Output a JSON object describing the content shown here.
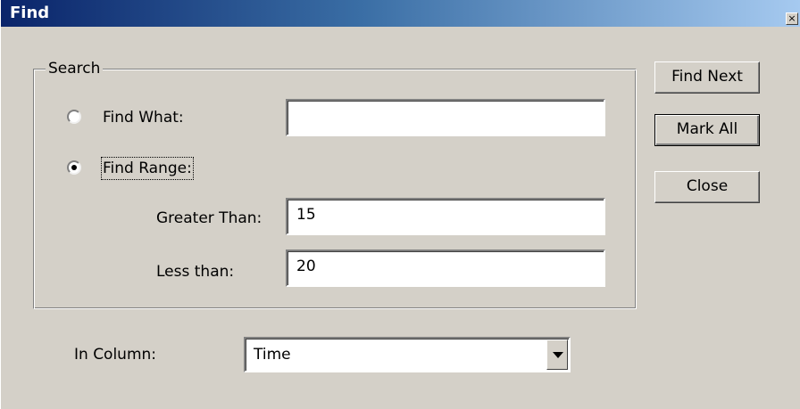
{
  "window": {
    "title": "Find",
    "close_glyph": "×"
  },
  "search_group": {
    "legend": "Search",
    "find_what": {
      "label": "Find What:",
      "value": "",
      "selected": false
    },
    "find_range": {
      "label": "Find Range:",
      "selected": true,
      "greater_than_label": "Greater Than:",
      "greater_than_value": "15",
      "less_than_label": "Less than:",
      "less_than_value": "20"
    }
  },
  "buttons": {
    "find_next": "Find Next",
    "mark_all": "Mark All",
    "close": "Close"
  },
  "column": {
    "label": "In Column:",
    "selected": "Time"
  },
  "colors": {
    "title_gradient_start": "#0a246a",
    "title_gradient_end": "#a6caf0",
    "face": "#d4d0c8"
  }
}
